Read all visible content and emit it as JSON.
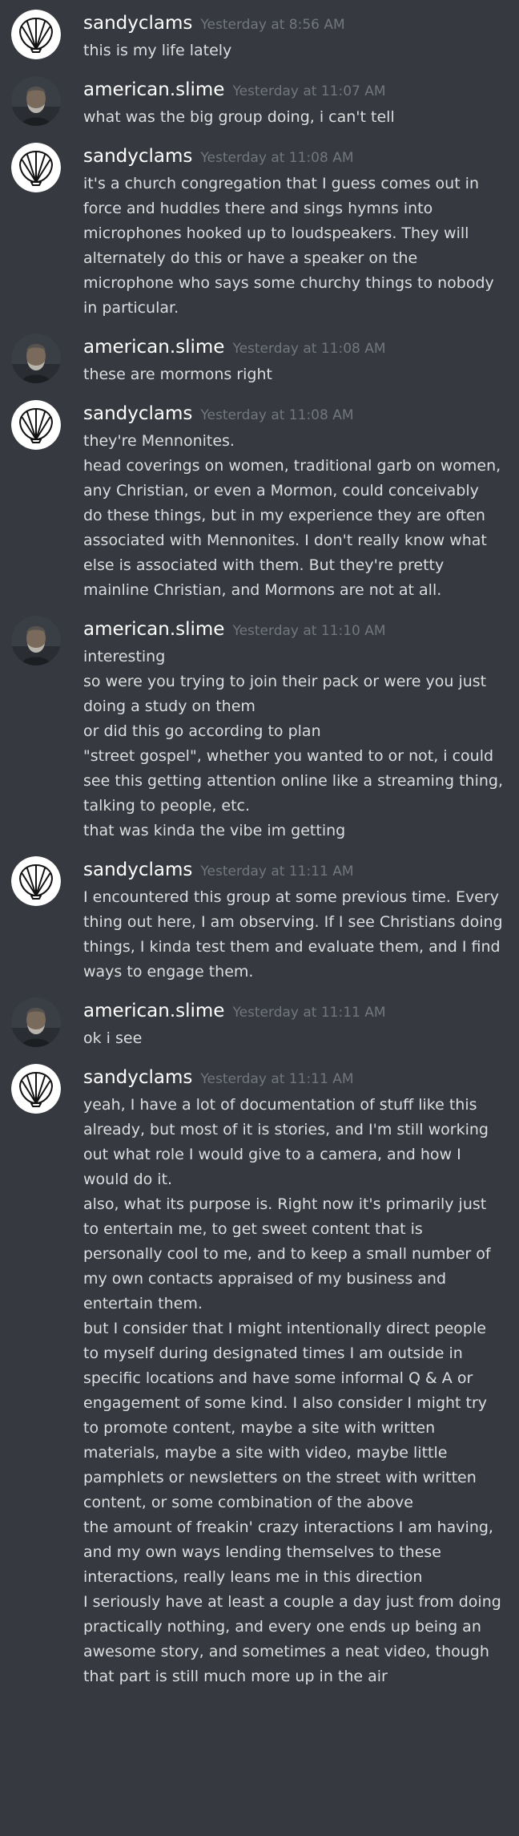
{
  "messages": [
    {
      "user": "sandyclams",
      "avatar": "shell-icon",
      "time": "Yesterday at 8:56 AM",
      "lines": [
        "this is my life lately"
      ]
    },
    {
      "user": "american.slime",
      "avatar": "user-photo",
      "time": "Yesterday at 11:07 AM",
      "lines": [
        "what was the big group doing, i can't tell"
      ]
    },
    {
      "user": "sandyclams",
      "avatar": "shell-icon",
      "time": "Yesterday at 11:08 AM",
      "lines": [
        "it's a church congregation that I guess comes out in",
        "force and huddles there and sings hymns into",
        "microphones hooked up to loudspeakers. They will",
        "alternately do this or have a speaker on the",
        "microphone who says some churchy things to nobody",
        "in particular."
      ]
    },
    {
      "user": "american.slime",
      "avatar": "user-photo",
      "time": "Yesterday at 11:08 AM",
      "lines": [
        "these are mormons right"
      ]
    },
    {
      "user": "sandyclams",
      "avatar": "shell-icon",
      "time": "Yesterday at 11:08 AM",
      "lines": [
        "they're Mennonites.",
        "head coverings on women, traditional garb on women,",
        "any Christian, or even a Mormon, could conceivably",
        "do these things, but in my experience they are often",
        "associated with Mennonites. I don't really know what",
        "else is associated with them. But they're pretty",
        "mainline Christian, and Mormons are not at all."
      ]
    },
    {
      "user": "american.slime",
      "avatar": "user-photo",
      "time": "Yesterday at 11:10 AM",
      "lines": [
        "interesting",
        "so were you trying to join their pack or were you just",
        "doing a study on them",
        "or did this go according to plan",
        "\"street gospel\", whether you wanted to or not, i could",
        "see this getting attention online like a streaming thing,",
        "talking to people, etc.",
        "that was kinda the vibe im getting"
      ]
    },
    {
      "user": "sandyclams",
      "avatar": "shell-icon",
      "time": "Yesterday at 11:11 AM",
      "lines": [
        "I encountered this group at some previous time. Every",
        "thing out here, I am observing. If I see Christians doing",
        "things, I kinda test them and evaluate them, and I find",
        "ways to engage them."
      ]
    },
    {
      "user": "american.slime",
      "avatar": "user-photo",
      "time": "Yesterday at 11:11 AM",
      "lines": [
        "ok i see"
      ]
    },
    {
      "user": "sandyclams",
      "avatar": "shell-icon",
      "time": "Yesterday at 11:11 AM",
      "lines": [
        "yeah, I have a lot of documentation of stuff like this",
        "already, but most of it is stories, and I'm still working",
        "out what role I would give to a camera, and how I",
        "would do it.",
        "also, what its purpose is. Right now it's primarily just",
        "to entertain me, to get sweet content that is",
        "personally cool to me, and to keep a small number of",
        "my own contacts appraised of my business and",
        "entertain them.",
        "but I consider that I might intentionally direct people",
        "to myself during designated times I am outside in",
        "specific locations and have some informal Q & A or",
        "engagement of some kind. I also consider I might try",
        "to promote content, maybe a site with written",
        "materials, maybe a site with video, maybe little",
        "pamphlets or newsletters on the street with written",
        "content, or some combination of the above",
        "the amount of freakin' crazy interactions I am having,",
        "and my own ways lending themselves to these",
        "interactions, really leans me in this direction",
        "I seriously have at least a couple a day just from doing",
        "practically nothing, and every one ends up being an",
        "awesome story, and sometimes a neat video, though",
        "that part is still much more up in the air"
      ]
    }
  ]
}
